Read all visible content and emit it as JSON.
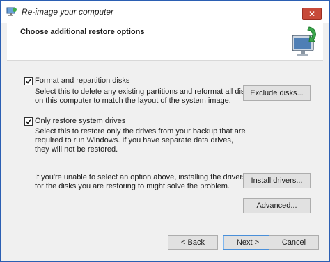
{
  "window": {
    "title": "Re-image your computer",
    "close_symbol": "✕"
  },
  "header": {
    "title": "Choose additional restore options",
    "icon": "restore-computer-icon"
  },
  "options": {
    "format": {
      "label": "Format and repartition disks",
      "checked": true,
      "desc_line1": "Select this to delete any existing partitions and reformat all disks",
      "desc_line2": "on this computer to match the layout of the system image."
    },
    "restore_system": {
      "label": "Only restore system drives",
      "checked": true,
      "desc_line1": "Select this to restore only the drives from your backup that are",
      "desc_line2": "required to run Windows. If you have separate data drives,",
      "desc_line3": "they will not be restored."
    }
  },
  "drivers_info": {
    "line1": "If you're unable to select an option above, installing the drivers",
    "line2": "for the disks you are restoring to might solve the problem."
  },
  "buttons": {
    "exclude_disks": "Exclude disks...",
    "install_drivers": "Install drivers...",
    "advanced": "Advanced...",
    "back": "< Back",
    "next": "Next >",
    "cancel": "Cancel"
  },
  "colors": {
    "window_border": "#2b5fb3",
    "close_button": "#c74a3a",
    "default_button_border": "#4a8fd8"
  }
}
